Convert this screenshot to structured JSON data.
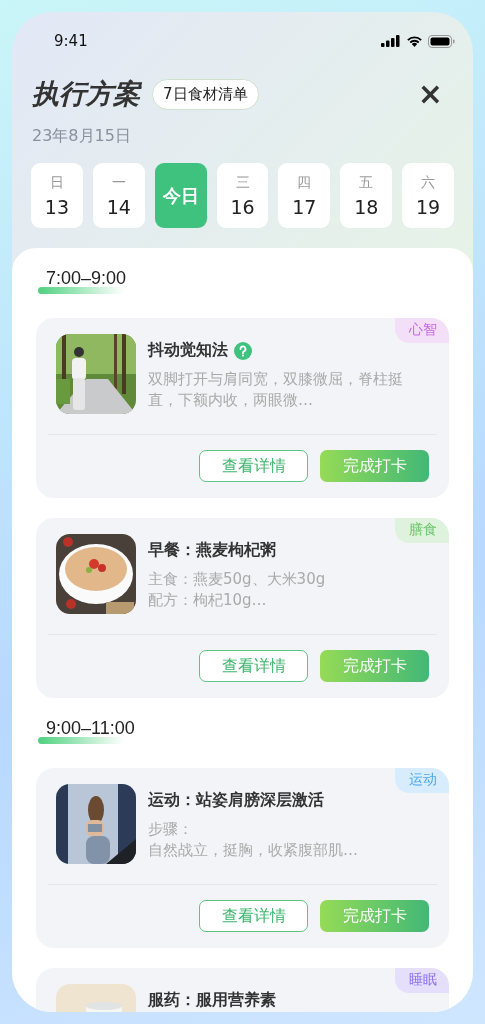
{
  "status_bar": {
    "time": "9:41"
  },
  "header": {
    "title": "执行方案",
    "chip": "7日食材清单",
    "close": "×",
    "date": "23年8月15日"
  },
  "days": [
    {
      "weekday": "日",
      "date": "13",
      "selected": false
    },
    {
      "weekday": "一",
      "date": "14",
      "selected": false
    },
    {
      "label": "今日",
      "selected": true
    },
    {
      "weekday": "三",
      "date": "16",
      "selected": false
    },
    {
      "weekday": "四",
      "date": "17",
      "selected": false
    },
    {
      "weekday": "五",
      "date": "18",
      "selected": false
    },
    {
      "weekday": "六",
      "date": "19",
      "selected": false
    }
  ],
  "slots": [
    {
      "time": "7:00–9:00",
      "cards": [
        {
          "title": "抖动觉知法",
          "help": true,
          "tag": "心智",
          "color": "#c76ce0",
          "description": [
            "双脚打开与肩同宽，双膝微屈，脊柱挺直，下额内收，两眼微…"
          ],
          "buttons": [
            {
              "kind": "outline",
              "label": "查看详情"
            },
            {
              "kind": "filled",
              "label": "完成打卡"
            }
          ]
        },
        {
          "title": "早餐：燕麦枸杞粥",
          "help": false,
          "tag": "膳食",
          "color": "#6cc46a",
          "description": [
            "主食：燕麦50g、大米30g",
            "配方：枸杞10g…"
          ],
          "buttons": [
            {
              "kind": "outline",
              "label": "查看详情"
            },
            {
              "kind": "filled",
              "label": "完成打卡"
            }
          ]
        }
      ]
    },
    {
      "time": "9:00–11:00",
      "cards": [
        {
          "title": "运动：站姿肩膀深层激活",
          "help": false,
          "tag": "运动",
          "color": "#4aa8f0",
          "description": [
            "步骤：",
            "自然战立，挺胸，收紧腹部肌…"
          ],
          "buttons": [
            {
              "kind": "outline",
              "label": "查看详情"
            },
            {
              "kind": "filled",
              "label": "完成打卡"
            }
          ]
        },
        {
          "title": "服药：服用营养素",
          "help": false,
          "tag": "睡眠",
          "color": "#8a6ff0"
        }
      ]
    }
  ]
}
